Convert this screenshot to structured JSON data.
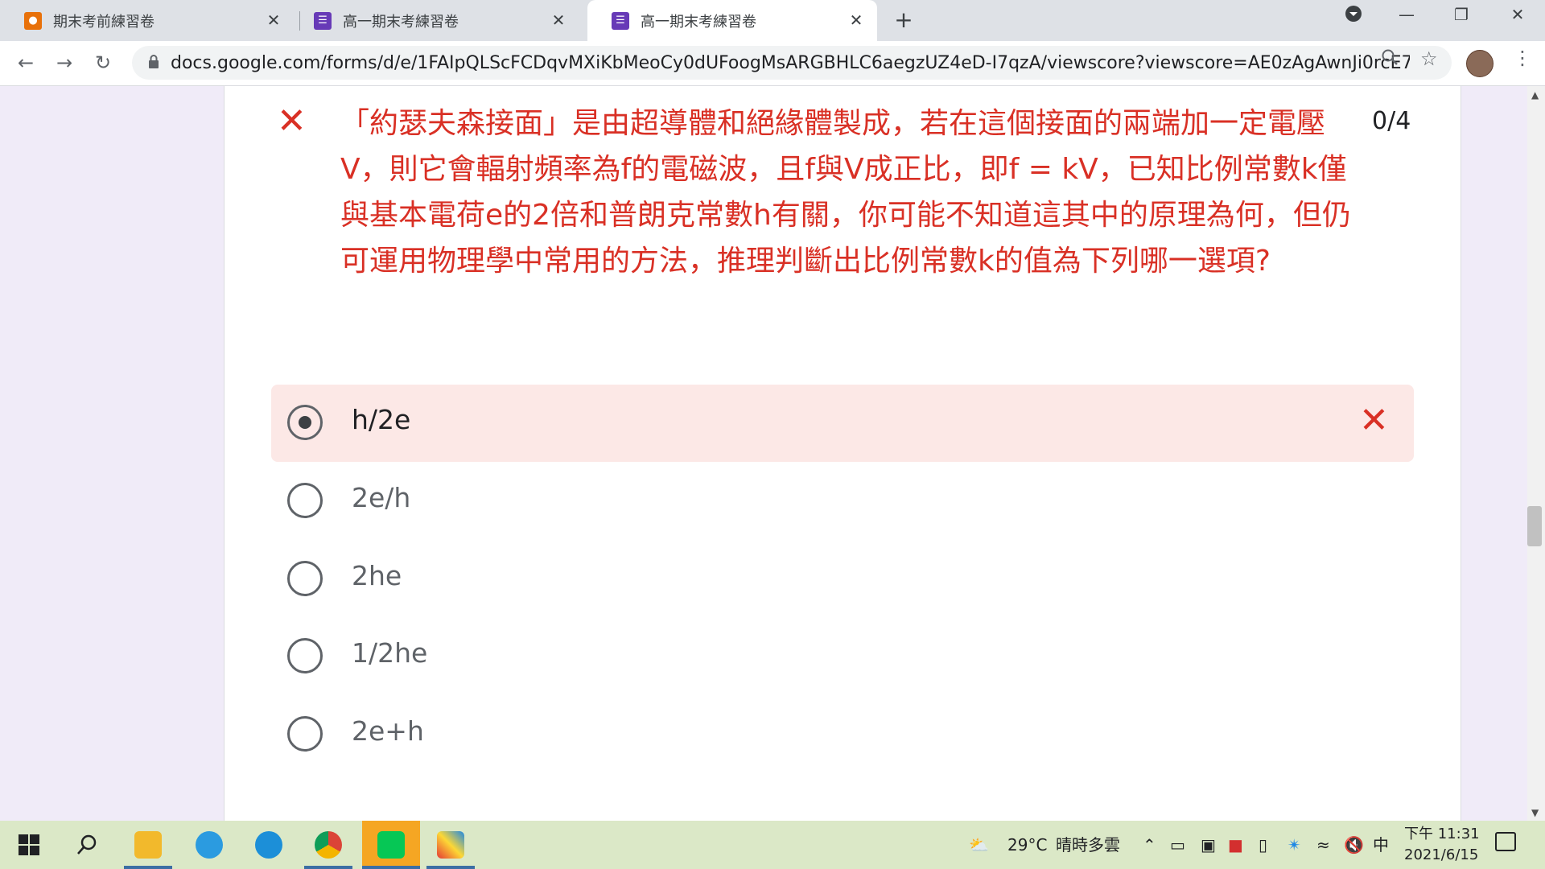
{
  "tabs": [
    {
      "label": "期末考前練習卷",
      "icon": "contacts-form-icon",
      "color": "#e8710a"
    },
    {
      "label": "高一期末考練習卷",
      "icon": "forms-icon",
      "color": "#673ab7"
    },
    {
      "label": "高一期末考練習卷",
      "icon": "forms-icon",
      "color": "#673ab7",
      "active": true
    }
  ],
  "address_bar": {
    "url": "docs.google.com/forms/d/e/1FAIpQLScFCDqvMXiKbMeoCy0dUFoogMsARGBHLC6aegzUZ4eD-I7qzA/viewscore?viewscore=AE0zAgAwnJi0rcE7oTU..."
  },
  "question": {
    "text": "「約瑟夫森接面」是由超導體和絕緣體製成，若在這個接面的兩端加一定電壓V，則它會輻射頻率為f的電磁波，且f與V成正比，即f = kV，已知比例常數k僅與基本電荷e的2倍和普朗克常數h有關，你可能不知道這其中的原理為何，但仍可運用物理學中常用的方法，推理判斷出比例常數k的值為下列哪一選項?",
    "score": "0/4",
    "status_color": "#d93025"
  },
  "options": [
    {
      "label": "h/2e",
      "selected": true,
      "incorrect": true
    },
    {
      "label": "2e/h",
      "selected": false
    },
    {
      "label": "2he",
      "selected": false
    },
    {
      "label": "1/2he",
      "selected": false
    },
    {
      "label": "2e+h",
      "selected": false
    }
  ],
  "taskbar": {
    "weather": "29°C",
    "weather_desc": "晴時多雲",
    "ime": "中",
    "time": "下午 11:31",
    "date": "2021/6/15"
  }
}
